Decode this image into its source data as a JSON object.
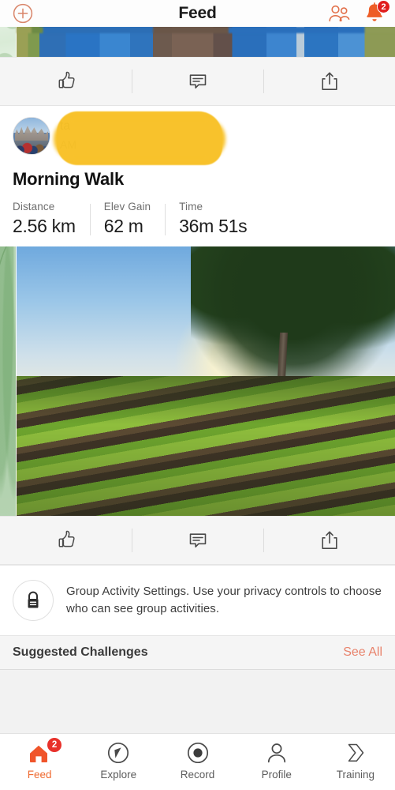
{
  "header": {
    "title": "Feed",
    "add_icon": "plus-circle-icon",
    "friends_icon": "group-people-icon",
    "notifications_icon": "bell-icon",
    "notifications_badge": "2",
    "accent_color": "#ef6a30",
    "badge_color": "#e01e1e"
  },
  "actions": {
    "kudos_label": "kudos",
    "comment_label": "comment",
    "share_label": "share"
  },
  "activity": {
    "author_name_redacted": "ta",
    "author_time_redacted": "AM",
    "redaction_color": "#f8c126",
    "title": "Morning Walk",
    "stats": [
      {
        "label": "Distance",
        "value": "2.56 km"
      },
      {
        "label": "Elev Gain",
        "value": "62 m"
      },
      {
        "label": "Time",
        "value": "36m 51s"
      }
    ]
  },
  "notice": {
    "icon": "lock-icon",
    "text": "Group Activity Settings. Use your privacy controls to choose who can see group activities."
  },
  "suggested": {
    "title": "Suggested Challenges",
    "see_all": "See All",
    "link_color": "#e8826b"
  },
  "tabbar": {
    "items": [
      {
        "label": "Feed",
        "icon": "home-icon",
        "active": true,
        "badge": "2"
      },
      {
        "label": "Explore",
        "icon": "compass-icon",
        "active": false,
        "badge": ""
      },
      {
        "label": "Record",
        "icon": "record-dot-icon",
        "active": false,
        "badge": ""
      },
      {
        "label": "Profile",
        "icon": "person-icon",
        "active": false,
        "badge": ""
      },
      {
        "label": "Training",
        "icon": "chevron-arrow-icon",
        "active": false,
        "badge": ""
      }
    ]
  }
}
